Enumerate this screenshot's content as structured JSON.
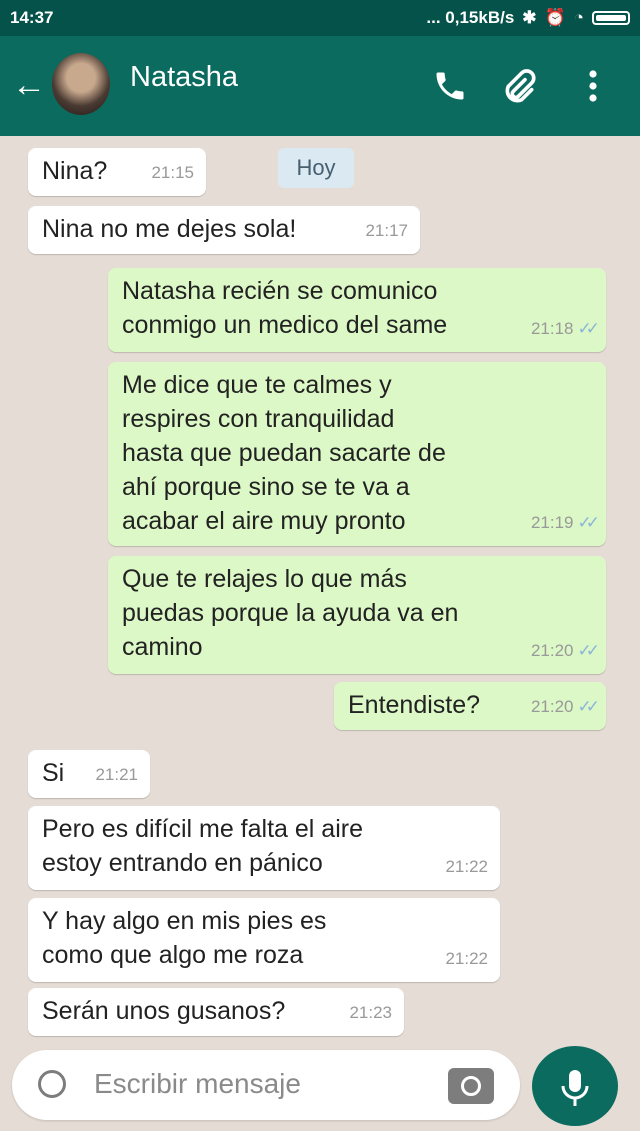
{
  "status": {
    "time": "14:37",
    "net": "... 0,15kB/s"
  },
  "header": {
    "contact": "Natasha"
  },
  "date_chip": "Hoy",
  "messages": [
    {
      "dir": "in",
      "text": "Nina?",
      "time": "21:15"
    },
    {
      "dir": "in",
      "text": "Nina no me dejes sola!",
      "time": "21:17"
    },
    {
      "dir": "out",
      "line1": "Natasha recién se comunico",
      "line2": "conmigo un medico del same",
      "time": "21:18"
    },
    {
      "dir": "out",
      "lines": [
        "Me dice que te calmes y",
        "respires con tranquilidad",
        "hasta que puedan sacarte de",
        "ahí porque sino se te va a",
        "acabar el aire muy pronto"
      ],
      "time": "21:19"
    },
    {
      "dir": "out",
      "lines": [
        "Que te relajes lo que más",
        "puedas porque la ayuda va en",
        "camino"
      ],
      "time": "21:20"
    },
    {
      "dir": "out",
      "text": "Entendiste?",
      "time": "21:20"
    },
    {
      "dir": "in",
      "text": "Si",
      "time": "21:21"
    },
    {
      "dir": "in",
      "lines": [
        "Pero es difícil me falta el aire",
        "estoy entrando en pánico"
      ],
      "time": "21:22"
    },
    {
      "dir": "in",
      "lines": [
        "Y hay algo en mis pies es",
        "como que algo me roza"
      ],
      "time": "21:22"
    },
    {
      "dir": "in",
      "text": "Serán unos gusanos?",
      "time": "21:23"
    }
  ],
  "composer": {
    "placeholder": "Escribir mensaje"
  },
  "colors": {
    "header": "#0b6b5f",
    "outgoing": "#dcf8c6",
    "incoming": "#ffffff",
    "ticks": "#8ab4d8"
  },
  "icons": [
    "back-arrow-icon",
    "phone-icon",
    "paperclip-icon",
    "more-vert-icon",
    "emoji-icon",
    "camera-icon",
    "mic-icon"
  ]
}
